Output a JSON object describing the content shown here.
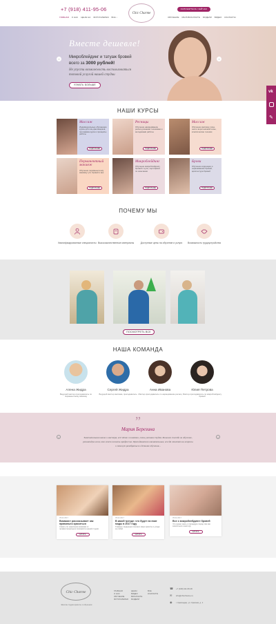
{
  "header": {
    "phone": "+7 (918) 411-95-06",
    "nav_left": [
      "ГЛАВНАЯ",
      "О НАС",
      "ЦЕНЫ НА",
      "ФОТОГАЛЕРЕЯ",
      "ВСЕ ↓"
    ],
    "logo": "Chic Charme",
    "callback": "ЗАПИШИТЕСЬ СЕЙЧАС",
    "nav_right": [
      "ОБУЧЕНИЕ",
      "МЫ В ВКОНТАКТЕ",
      "МОДЕЛИ",
      "ВИДЕО",
      "КОНТАКТЫ"
    ]
  },
  "hero": {
    "script_title": "Вместе дешевле!",
    "line1": "Микроблейдинг и татуаж бровей",
    "line2_prefix": "всего за",
    "line2_price": "3000 рублей!",
    "italic1": "Не упусти возможность воспользоваться",
    "italic2": "топовой услугой нашей студии",
    "button": "УЗНАТЬ БОЛЬШЕ"
  },
  "courses": {
    "heading": "НАШИ КУРСЫ",
    "items": [
      {
        "name": "Массаж",
        "desc": "Индивидуальные обучающие курсы для лиц-фасовщиков, программа курса и принципы работы",
        "more": "ПОДРОБНЕЕ"
      },
      {
        "name": "Ресницы",
        "desc": "Обучение наращиванию ресниц разными техниками и методиками работы",
        "more": "ПОДРОБНЕЕ"
      },
      {
        "name": "Массаж",
        "desc": "Обучение массажу лица, шеи и воротниковой зоны, классические техники",
        "more": "ПОДРОБНЕЕ"
      },
      {
        "name": "Перманентный макияж",
        "desc": "Обучение перманентному макияжу губ, бровей и век",
        "more": "ПОДРОБНЕЕ"
      },
      {
        "name": "Микроблейдинг",
        "desc": "Обучение микроблейдингу бровей с нуля, сертификат по окончании",
        "more": "ПОДРОБНЕЕ"
      },
      {
        "name": "Брови",
        "desc": "Обучение коррекции и окрашиванию бровей, архитектура бровей",
        "more": "ПОДРОБНЕЕ"
      }
    ]
  },
  "why": {
    "heading": "ПОЧЕМУ МЫ",
    "items": [
      {
        "text": "Квалифицированные специалисты"
      },
      {
        "text": "Высококачественные материалы"
      },
      {
        "text": "Доступные цены на обучение и услуги"
      },
      {
        "text": "Возможность трудоустройства"
      }
    ]
  },
  "gallery": {
    "button": "ПОСМОТРЕТЬ ВСЕ"
  },
  "team": {
    "heading": "НАША КОМАНДА",
    "members": [
      {
        "name": "Алена Жидра",
        "desc": "Ведущий мастер-преподаватель по перманентному макияжу"
      },
      {
        "name": "Сергей Жидра",
        "desc": "Ведущий мастер массажа, преподаватель"
      },
      {
        "name": "Анна Иванова",
        "desc": "Мастер-преподаватель по наращиванию ресниц"
      },
      {
        "name": "Юлия Петрова",
        "desc": "Мастер-преподаватель по микроблейдингу бровей"
      }
    ]
  },
  "review": {
    "quote_mark": "”",
    "author": "Мария Березина",
    "text1": "Замечательная школа и мастера, всё чётко и понятно, очень уютная студия. Большое спасибо за обучение,",
    "text2": "рекомендую всем, кто хочет освоить профессию. Преподаватели внимательные, всегда ответят на вопросы",
    "text3": "и помогут разобраться в деталях обучения..."
  },
  "articles": [
    {
      "date": "05.02.2017",
      "title": "Визажист рассказывает как правильно краситься",
      "excerpt": "Советы по нанесению макияжа от профессионального визажиста нашей студии",
      "more": "ЧИТАТЬ"
    },
    {
      "date": "05.02.2017",
      "title": "В какой тренде: что будет на пике моды в 2017 году",
      "excerpt": "Главные тенденции сезона в мире красоты и ухода за собой",
      "more": "ЧИТАТЬ"
    },
    {
      "date": "05.02.2017",
      "title": "Все о микроблейдинге бровей",
      "excerpt": "Что нужно знать о процедуре перед тем как записаться к мастеру",
      "more": "ЧИТАТЬ"
    }
  ],
  "footer": {
    "logo": "Chic Charme",
    "tagline": "Школа-студия красоты и обучения",
    "col1": [
      "ГЛАВНАЯ",
      "О НАС",
      "ОБУЧЕНИЕ",
      "ФОТОГАЛЕРЕЯ"
    ],
    "col2": [
      "ЦЕНЫ",
      "ВИДЕО",
      "ВКОНТАКТЕ",
      "МОДЕЛИ"
    ],
    "col3": [
      "ВСЕ",
      "КОНТАКТЫ"
    ],
    "phone": "+7 (918) 411-95-06",
    "email": "info@chiccharme.ru",
    "address": "г. Краснодар, ул. Красная, д. 1"
  },
  "colors": {
    "accent": "#a02566",
    "hero_bg": "#c9c5dc"
  },
  "social": [
    "vk-icon",
    "instagram-icon",
    "edit-icon"
  ]
}
